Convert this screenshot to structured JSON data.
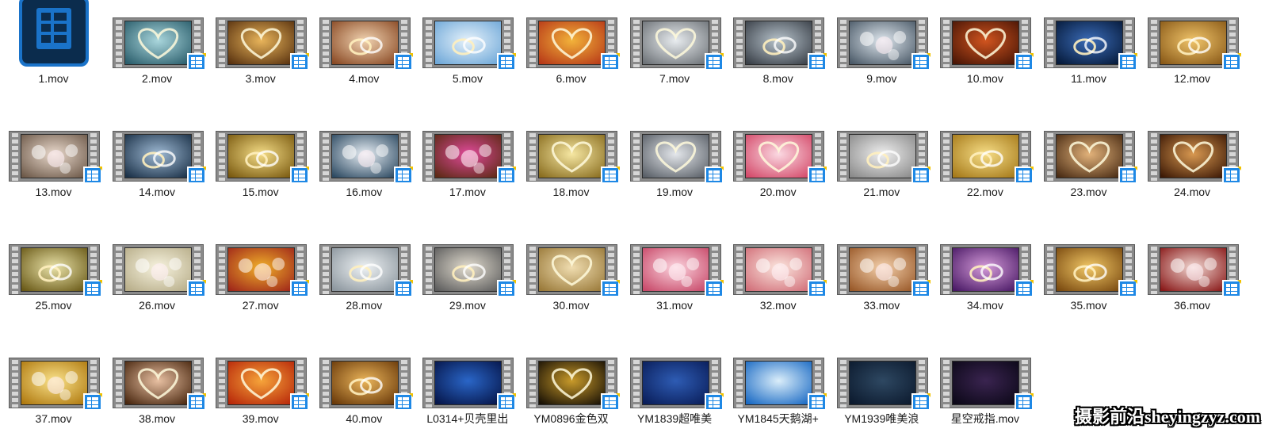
{
  "files": [
    {
      "name": "1.mov",
      "icon": "video-app-icon",
      "c1": "#1a73c9",
      "c2": "#0b2c4d",
      "motif": "none"
    },
    {
      "name": "2.mov",
      "icon": "video-file-icon",
      "c1": "#2b5e6c",
      "c2": "#a9d6dc",
      "motif": "heart"
    },
    {
      "name": "3.mov",
      "icon": "video-file-icon",
      "c1": "#5a3310",
      "c2": "#e8b45a",
      "motif": "heart"
    },
    {
      "name": "4.mov",
      "icon": "video-file-icon",
      "c1": "#8a4a25",
      "c2": "#f0d2b0",
      "motif": "rings"
    },
    {
      "name": "5.mov",
      "icon": "video-file-icon",
      "c1": "#6fa8d8",
      "c2": "#e6f2fb",
      "motif": "rings"
    },
    {
      "name": "6.mov",
      "icon": "video-file-icon",
      "c1": "#b83a18",
      "c2": "#f2b23a",
      "motif": "heart"
    },
    {
      "name": "7.mov",
      "icon": "video-file-icon",
      "c1": "#6e7378",
      "c2": "#e8ecef",
      "motif": "heart"
    },
    {
      "name": "8.mov",
      "icon": "video-file-icon",
      "c1": "#3a4048",
      "c2": "#b7c3cc",
      "motif": "rings"
    },
    {
      "name": "9.mov",
      "icon": "video-file-icon",
      "c1": "#4b5a68",
      "c2": "#dfe7ee",
      "motif": "flowers"
    },
    {
      "name": "10.mov",
      "icon": "video-file-icon",
      "c1": "#4a1606",
      "c2": "#d0541f",
      "motif": "heart"
    },
    {
      "name": "11.mov",
      "icon": "video-file-icon",
      "c1": "#061a3a",
      "c2": "#3b6cb8",
      "motif": "rings"
    },
    {
      "name": "12.mov",
      "icon": "video-file-icon",
      "c1": "#8a5a18",
      "c2": "#f0c46a",
      "motif": "rings"
    },
    {
      "name": "13.mov",
      "icon": "video-file-icon",
      "c1": "#6e5a4a",
      "c2": "#e9d9cc",
      "motif": "flowers"
    },
    {
      "name": "14.mov",
      "icon": "video-file-icon",
      "c1": "#1b3148",
      "c2": "#9fbad4",
      "motif": "rings"
    },
    {
      "name": "15.mov",
      "icon": "video-file-icon",
      "c1": "#7a5a10",
      "c2": "#f4dc86",
      "motif": "rings"
    },
    {
      "name": "16.mov",
      "icon": "video-file-icon",
      "c1": "#2d4a62",
      "c2": "#e7eef4",
      "motif": "flowers"
    },
    {
      "name": "17.mov",
      "icon": "video-file-icon",
      "c1": "#5e2a16",
      "c2": "#e04a9a",
      "motif": "flowers"
    },
    {
      "name": "18.mov",
      "icon": "video-file-icon",
      "c1": "#8a6e20",
      "c2": "#f6e7a2",
      "motif": "heart"
    },
    {
      "name": "19.mov",
      "icon": "video-file-icon",
      "c1": "#5a6068",
      "c2": "#e4e7eb",
      "motif": "heart"
    },
    {
      "name": "20.mov",
      "icon": "video-file-icon",
      "c1": "#d44a6a",
      "c2": "#fbd9e2",
      "motif": "heart"
    },
    {
      "name": "21.mov",
      "icon": "video-file-icon",
      "c1": "#8a8a8a",
      "c2": "#efefef",
      "motif": "rings"
    },
    {
      "name": "22.mov",
      "icon": "video-file-icon",
      "c1": "#a67a1a",
      "c2": "#f6dd86",
      "motif": "rings"
    },
    {
      "name": "23.mov",
      "icon": "video-file-icon",
      "c1": "#4a2c14",
      "c2": "#e2b27a",
      "motif": "heart"
    },
    {
      "name": "24.mov",
      "icon": "video-file-icon",
      "c1": "#3e1a06",
      "c2": "#d89850",
      "motif": "heart"
    },
    {
      "name": "25.mov",
      "icon": "video-file-icon",
      "c1": "#6a5a18",
      "c2": "#e9e2a8",
      "motif": "rings"
    },
    {
      "name": "26.mov",
      "icon": "video-file-icon",
      "c1": "#b8ae8a",
      "c2": "#f7f3df",
      "motif": "flowers"
    },
    {
      "name": "27.mov",
      "icon": "video-file-icon",
      "c1": "#a0281a",
      "c2": "#f0b02a",
      "motif": "flowers"
    },
    {
      "name": "28.mov",
      "icon": "video-file-icon",
      "c1": "#8c969e",
      "c2": "#eef2f4",
      "motif": "rings"
    },
    {
      "name": "29.mov",
      "icon": "video-file-icon",
      "c1": "#5e5e5e",
      "c2": "#e2dccf",
      "motif": "rings"
    },
    {
      "name": "30.mov",
      "icon": "video-file-icon",
      "c1": "#9a7a3a",
      "c2": "#f0ddb0",
      "motif": "heart"
    },
    {
      "name": "31.mov",
      "icon": "video-file-icon",
      "c1": "#c84a6a",
      "c2": "#fbd3dd",
      "motif": "flowers"
    },
    {
      "name": "32.mov",
      "icon": "video-file-icon",
      "c1": "#d2707a",
      "c2": "#fbe6de",
      "motif": "flowers"
    },
    {
      "name": "33.mov",
      "icon": "video-file-icon",
      "c1": "#9a5a2a",
      "c2": "#f3cfaa",
      "motif": "flowers"
    },
    {
      "name": "34.mov",
      "icon": "video-file-icon",
      "c1": "#4a1a66",
      "c2": "#d49ad8",
      "motif": "rings"
    },
    {
      "name": "35.mov",
      "icon": "video-file-icon",
      "c1": "#7a4a10",
      "c2": "#f2c866",
      "motif": "rings"
    },
    {
      "name": "36.mov",
      "icon": "video-file-icon",
      "c1": "#8a1a1a",
      "c2": "#f0d6d0",
      "motif": "flowers"
    },
    {
      "name": "37.mov",
      "icon": "video-file-icon",
      "c1": "#b07a10",
      "c2": "#fae28a",
      "motif": "flowers"
    },
    {
      "name": "38.mov",
      "icon": "video-file-icon",
      "c1": "#4a2810",
      "c2": "#e8c0a2",
      "motif": "heart"
    },
    {
      "name": "39.mov",
      "icon": "video-file-icon",
      "c1": "#b8280a",
      "c2": "#f6a43a",
      "motif": "heart"
    },
    {
      "name": "40.mov",
      "icon": "video-file-icon",
      "c1": "#6a3a0a",
      "c2": "#eab45a",
      "motif": "rings"
    },
    {
      "name": "L0314+贝壳里出",
      "icon": "video-file-icon",
      "c1": "#06164a",
      "c2": "#2a66c8",
      "motif": "none"
    },
    {
      "name": "YM0896金色双",
      "icon": "video-file-icon",
      "c1": "#1a1206",
      "c2": "#c89a2a",
      "motif": "heart"
    },
    {
      "name": "YM1839超唯美",
      "icon": "video-file-icon",
      "c1": "#0a1e5a",
      "c2": "#2e5cb4",
      "motif": "none"
    },
    {
      "name": "YM1845天鹅湖+",
      "icon": "video-file-icon",
      "c1": "#1a6ac4",
      "c2": "#dbeefa",
      "motif": "none"
    },
    {
      "name": "YM1939唯美浪",
      "icon": "video-file-icon",
      "c1": "#0c1a2e",
      "c2": "#2e4862",
      "motif": "none"
    },
    {
      "name": "星空戒指.mov",
      "icon": "video-file-icon",
      "c1": "#0c0818",
      "c2": "#3a2450",
      "motif": "none"
    }
  ],
  "watermark": {
    "text": "摄影前沿sheyingzyz.com"
  }
}
